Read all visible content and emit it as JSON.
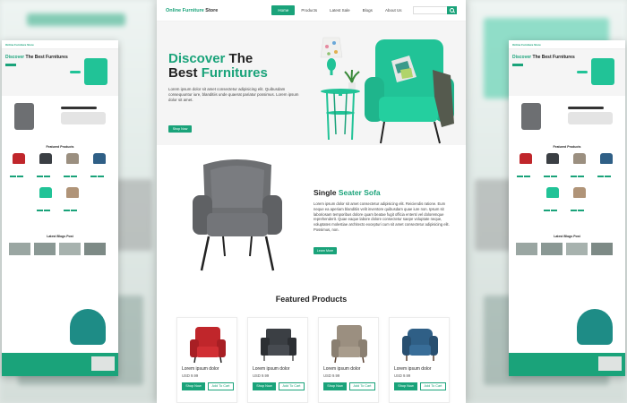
{
  "site": {
    "logo_main": "Online Furniture",
    "logo_rest": " Store"
  },
  "nav": {
    "items": [
      "Home",
      "Products",
      "Latest Sale",
      "Blogs",
      "About Us"
    ],
    "active": "Home",
    "search_placeholder": ""
  },
  "hero": {
    "title_accent_1": "Discover",
    "title_plain_1": " The",
    "title_plain_2": "Best ",
    "title_accent_2": "Furnitures",
    "text": "Lorem ipsum dolor sit amet consectetur adipisicing elit. Quibusdam consequuntur iure, blanditiis unde quaerat pariatur possimus. Lorem ipsum dolor sit amet.",
    "button": "Shop Now"
  },
  "single_sofa": {
    "title_plain": "Single ",
    "title_accent": "Seater Sofa",
    "text": "Lorem ipsum dolor sit amet consectetur adipisicing elit. Reiciendis ratione. Eum neque ea aperiam blanditiis velit inventore quibusdam quae iure non. Ipsum sit laboriosam temporibus dolore quam beatae fugit officia ententi vel doloremque reprehenderit. Quae eaque labore dolore consectetur saepe voluptate neque, voluptates molestiae architecto excepturi cum sit amet consectetur adipisicing elit. Possimus, non.",
    "button": "Learn More"
  },
  "featured": {
    "title": "Featured Products",
    "products": [
      {
        "name": "Lorem ipsum dolor",
        "price": "USD 9.99",
        "shop": "Shop Now",
        "cart": "Add To Cart",
        "color": "#c0262b"
      },
      {
        "name": "Lorem ipsum dolor",
        "price": "USD 9.99",
        "shop": "Shop Now",
        "cart": "Add To Cart",
        "color": "#3b3f44"
      },
      {
        "name": "Lorem ipsum dolor",
        "price": "USD 9.99",
        "shop": "Shop Now",
        "cart": "Add To Cart",
        "color": "#9b8f80"
      },
      {
        "name": "Lorem ipsum dolor",
        "price": "USD 9.99",
        "shop": "Shop Now",
        "cart": "Add To Cart",
        "color": "#2f5f86"
      }
    ]
  },
  "colors": {
    "accent": "#1aa37a",
    "teal_chair": "#21c397",
    "grey_chair": "#6d6f72"
  },
  "mini_mockups": {
    "logo": "Online Furniture Store",
    "title_accent": "Discover",
    "title_plain": " The Best Furnitures",
    "featured_heading": "Featured Products",
    "blog_heading": "Latest Blogs Post"
  }
}
